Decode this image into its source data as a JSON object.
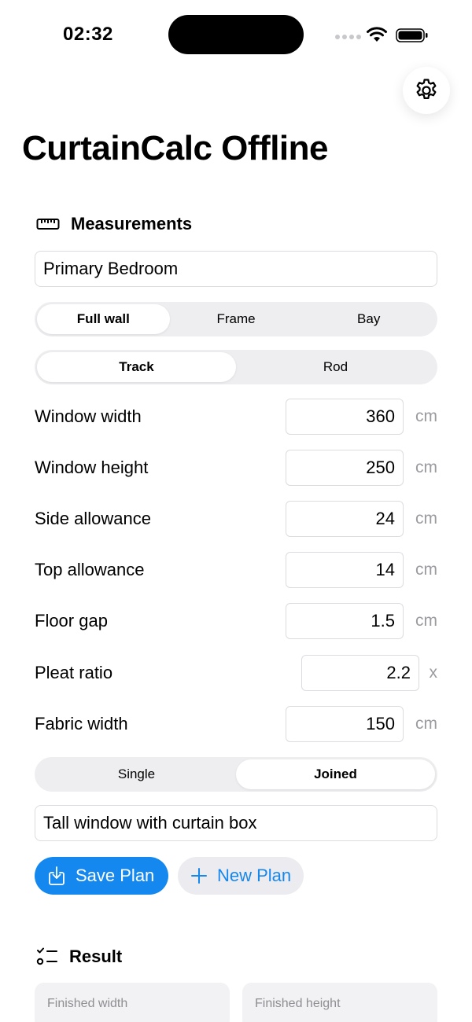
{
  "status_bar": {
    "time": "02:32"
  },
  "app": {
    "title": "CurtainCalc Offline"
  },
  "measurements": {
    "header": "Measurements",
    "room_name": "Primary Bedroom",
    "mount_segments": [
      "Full wall",
      "Frame",
      "Bay"
    ],
    "mount_selected": "Full wall",
    "hardware_segments": [
      "Track",
      "Rod"
    ],
    "hardware_selected": "Track",
    "fields": [
      {
        "label": "Window width",
        "value": "360",
        "unit": "cm"
      },
      {
        "label": "Window height",
        "value": "250",
        "unit": "cm"
      },
      {
        "label": "Side allowance",
        "value": "24",
        "unit": "cm"
      },
      {
        "label": "Top allowance",
        "value": "14",
        "unit": "cm"
      },
      {
        "label": "Floor gap",
        "value": "1.5",
        "unit": "cm"
      },
      {
        "label": "Pleat ratio",
        "value": "2.2",
        "unit": "x"
      },
      {
        "label": "Fabric width",
        "value": "150",
        "unit": "cm"
      }
    ],
    "panel_segments": [
      "Single",
      "Joined"
    ],
    "panel_selected": "Joined",
    "notes": "Tall window with curtain box"
  },
  "actions": {
    "save_label": "Save Plan",
    "new_label": "New Plan"
  },
  "result": {
    "header": "Result",
    "cards": [
      {
        "label": "Finished width"
      },
      {
        "label": "Finished height"
      }
    ]
  },
  "colors": {
    "accent": "#1488ef",
    "secondary_bg": "#ececf0",
    "muted": "#9a9aa0"
  },
  "icons": {
    "settings": "gear-icon",
    "measurements": "ruler-icon",
    "save": "download-tray-icon",
    "new": "plus-icon",
    "result": "checklist-icon"
  }
}
